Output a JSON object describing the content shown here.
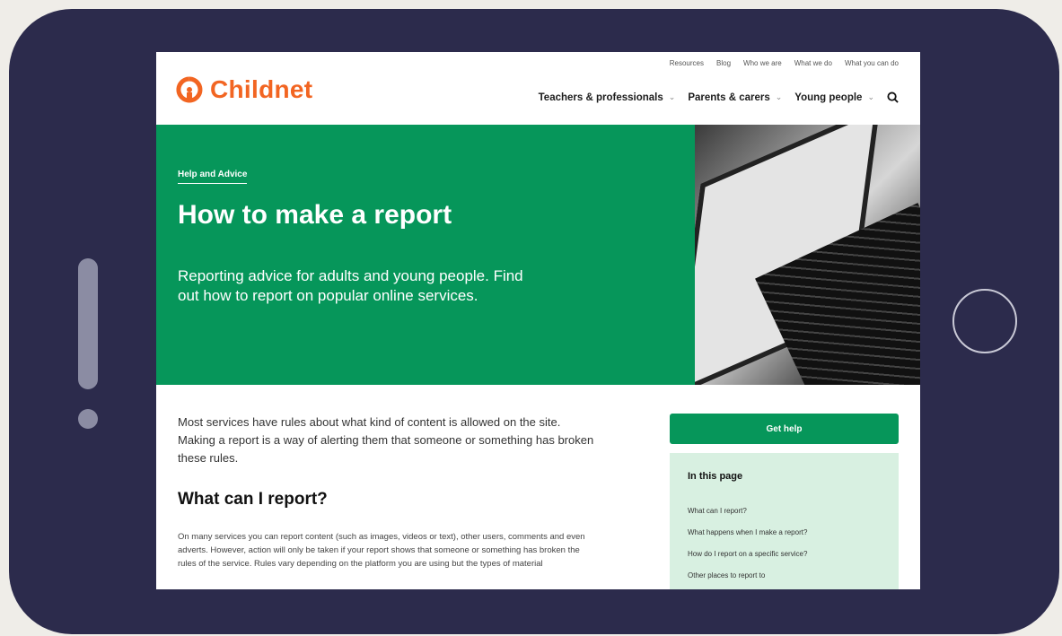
{
  "site": {
    "top_links": [
      "Resources",
      "Blog",
      "Who we are",
      "What we do",
      "What you can do"
    ],
    "logo_text": "Childnet",
    "nav": [
      {
        "label": "Teachers & professionals"
      },
      {
        "label": "Parents & carers"
      },
      {
        "label": "Young people"
      }
    ]
  },
  "hero": {
    "eyebrow": "Help and Advice",
    "title": "How to make a report",
    "subtitle": "Reporting advice for adults and young people. Find out how to report on popular online services."
  },
  "content": {
    "intro": "Most services have rules about what kind of content is allowed on the site. Making a report is a way of alerting them that someone or something has broken these rules.",
    "section_heading": "What can I report?",
    "section_body": "On many services you can report content (such as images, videos or text), other users, comments and even adverts. However, action will only be taken if your report shows that someone or something has broken the rules of the service. Rules vary depending on the platform you are using but the types of material"
  },
  "sidebar": {
    "get_help_label": "Get help",
    "toc_title": "In this page",
    "toc_items": [
      "What can I report?",
      "What happens when I make a report?",
      "How do I report on a specific service?",
      "Other places to report to"
    ]
  },
  "colors": {
    "brand_orange": "#f26522",
    "brand_green": "#06965a",
    "toc_bg": "#d8f0e1",
    "device_frame": "#2c2b4c"
  },
  "icons": [
    "childnet-logo-icon",
    "chevron-down-icon",
    "search-icon"
  ]
}
